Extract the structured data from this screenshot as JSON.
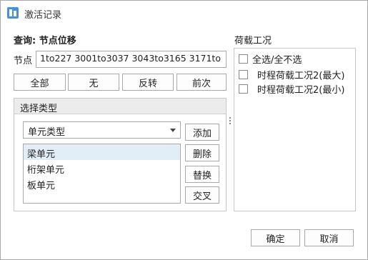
{
  "window": {
    "title": "激活记录"
  },
  "query": {
    "title": "查询: 节点位移"
  },
  "node": {
    "label": "节点",
    "value": "1to227 3001to3037 3043to3165 3171to"
  },
  "filter_buttons": {
    "all": "全部",
    "none": "无",
    "invert": "反转",
    "previous": "前次"
  },
  "type_group": {
    "header": "选择类型",
    "select_value": "单元类型",
    "items": [
      {
        "label": "梁单元",
        "selected": true
      },
      {
        "label": "桁架单元",
        "selected": false
      },
      {
        "label": "板单元",
        "selected": false
      }
    ],
    "buttons": {
      "add": "添加",
      "delete": "删除",
      "replace": "替换",
      "intersect": "交叉"
    }
  },
  "load_cases": {
    "title": "荷载工况",
    "select_all": "全选/全不选",
    "items": [
      {
        "label": "时程荷载工况2(最大)",
        "checked": false
      },
      {
        "label": "时程荷载工况2(最小)",
        "checked": false
      }
    ]
  },
  "footer": {
    "ok": "确定",
    "cancel": "取消"
  }
}
